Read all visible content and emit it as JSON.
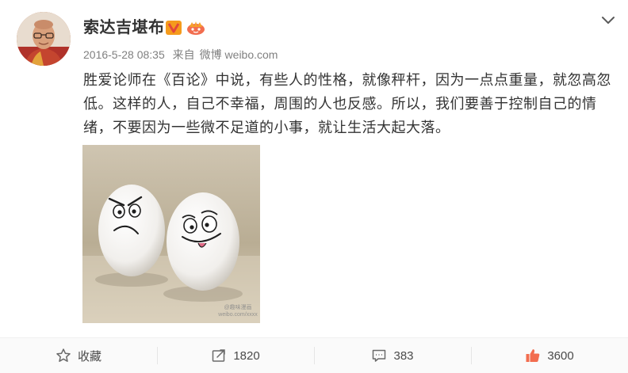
{
  "author": {
    "name": "索达吉堪布",
    "verified_icon": "verified-v-icon",
    "member_icon": "crown-icon"
  },
  "meta": {
    "time": "2016-5-28 08:35",
    "source_prefix": "来自",
    "source": "微博 weibo.com"
  },
  "post": {
    "text": "胜爱论师在《百论》中说，有些人的性格，就像秤杆，因为一点点重量，就忽高忽低。这样的人，自己不幸福，周围的人也反感。所以，我们要善于控制自己的情绪，不要因为一些微不足道的小事，就让生活大起大落。",
    "watermark_line1": "@趣味漫画",
    "watermark_line2": "weibo.com/xxxx"
  },
  "actions": {
    "favorite": "收藏",
    "repost": "1820",
    "comment": "383",
    "like": "3600"
  },
  "colors": {
    "like_red": "#f26d4f",
    "badge_orange": "#f6a22a",
    "badge_red": "#e2483b"
  }
}
